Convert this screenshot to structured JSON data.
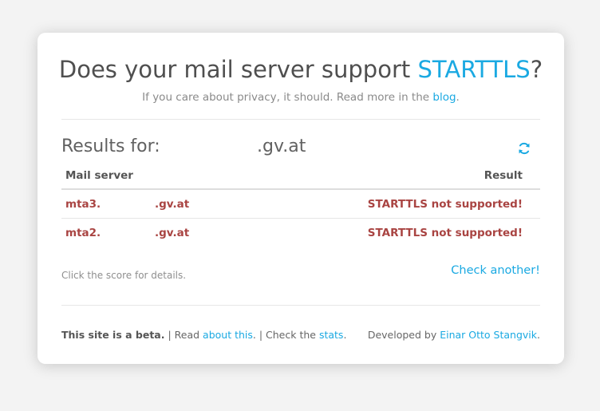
{
  "header": {
    "title_prefix": "Does your mail server support ",
    "title_accent": "STARTTLS",
    "title_suffix": "?",
    "subtitle_prefix": "If you care about privacy, it should. Read more in the ",
    "subtitle_link": "blog",
    "subtitle_suffix": "."
  },
  "results": {
    "label": "Results for:",
    "domain": ".gv.at",
    "refresh_icon": "refresh-icon",
    "columns": [
      "Mail server",
      "Result"
    ],
    "rows": [
      {
        "server_a": "mta3.",
        "server_b": ".gv.at",
        "result": "STARTTLS not supported!"
      },
      {
        "server_a": "mta2.",
        "server_b": ".gv.at",
        "result": "STARTTLS not supported!"
      }
    ],
    "status_color": "#a94442"
  },
  "actions": {
    "hint": "Click the score for details.",
    "check_another": "Check another!"
  },
  "footer": {
    "beta": "This site is a beta.",
    "read_prefix": " | Read ",
    "about_link": "about this",
    "check_prefix": ". | Check the ",
    "stats_link": "stats",
    "stats_suffix": ".",
    "developed_prefix": "Developed by ",
    "author_link": "Einar Otto Stangvik",
    "author_suffix": "."
  },
  "colors": {
    "accent": "#1aa9e2",
    "background": "#f3f3f3",
    "card": "#ffffff"
  }
}
